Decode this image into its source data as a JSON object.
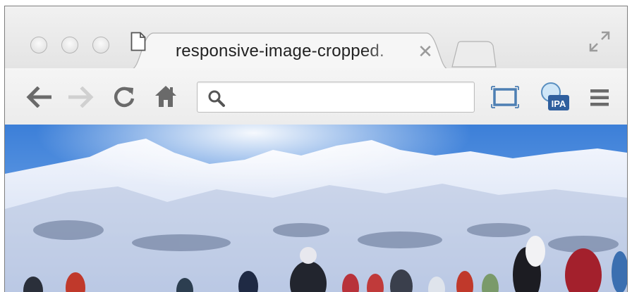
{
  "window": {
    "controls": [
      "close",
      "minimize",
      "zoom"
    ],
    "fullscreen_icon": "fullscreen-arrows-icon"
  },
  "tabs": [
    {
      "title": "responsive-image-cropped.",
      "icon": "document-icon",
      "close_glyph": "✕",
      "active": true
    }
  ],
  "toolbar": {
    "back_icon": "back-arrow-icon",
    "forward_icon": "forward-arrow-icon",
    "reload_icon": "reload-icon",
    "home_icon": "home-icon",
    "omnibox": {
      "value": "",
      "placeholder": ""
    },
    "extensions": [
      {
        "name": "responsive-frame-icon"
      },
      {
        "name": "ipa-icon",
        "label": "IPA"
      }
    ],
    "menu_icon": "hamburger-menu-icon"
  },
  "page": {
    "image": {
      "subject": "snowy mountain with skiers",
      "colors": {
        "sky": "#4f8fe0",
        "snow": "#e9eef9",
        "shadow": "#9aa9cc"
      }
    }
  }
}
